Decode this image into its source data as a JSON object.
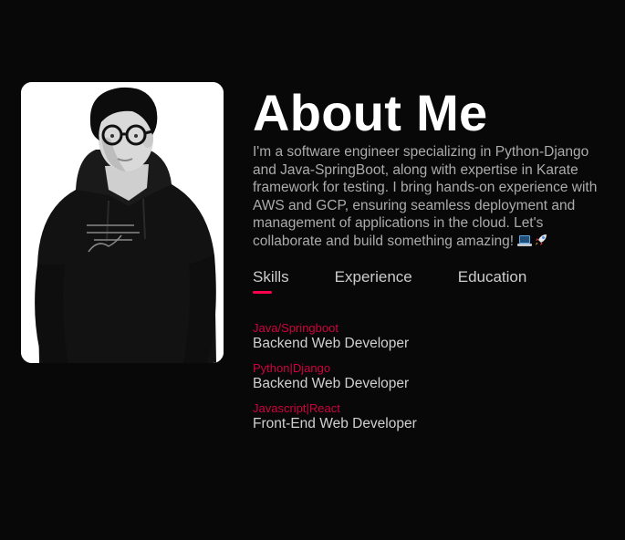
{
  "profile": {
    "photo_alt": "Portrait photo"
  },
  "about": {
    "title": "About Me",
    "intro": "I'm a software engineer specializing in Python-Django and Java-SpringBoot, along with expertise in Karate framework for testing. I bring hands-on experience with AWS and GCP, ensuring seamless deployment and management of applications in the cloud. Let's collaborate and build something amazing!",
    "emojis": [
      "laptop-icon",
      "rocket-icon"
    ]
  },
  "tabs": [
    {
      "label": "Skills",
      "active": true
    },
    {
      "label": "Experience",
      "active": false
    },
    {
      "label": "Education",
      "active": false
    }
  ],
  "skills": [
    {
      "name": "Java/Springboot",
      "role": "Backend Web Developer"
    },
    {
      "name": "Python|Django",
      "role": "Backend Web Developer"
    },
    {
      "name": "Javascript|React",
      "role": "Front-End Web Developer"
    }
  ],
  "colors": {
    "background": "#080808",
    "accent": "#ff004f",
    "text": "#ababab",
    "heading": "#ffffff"
  }
}
